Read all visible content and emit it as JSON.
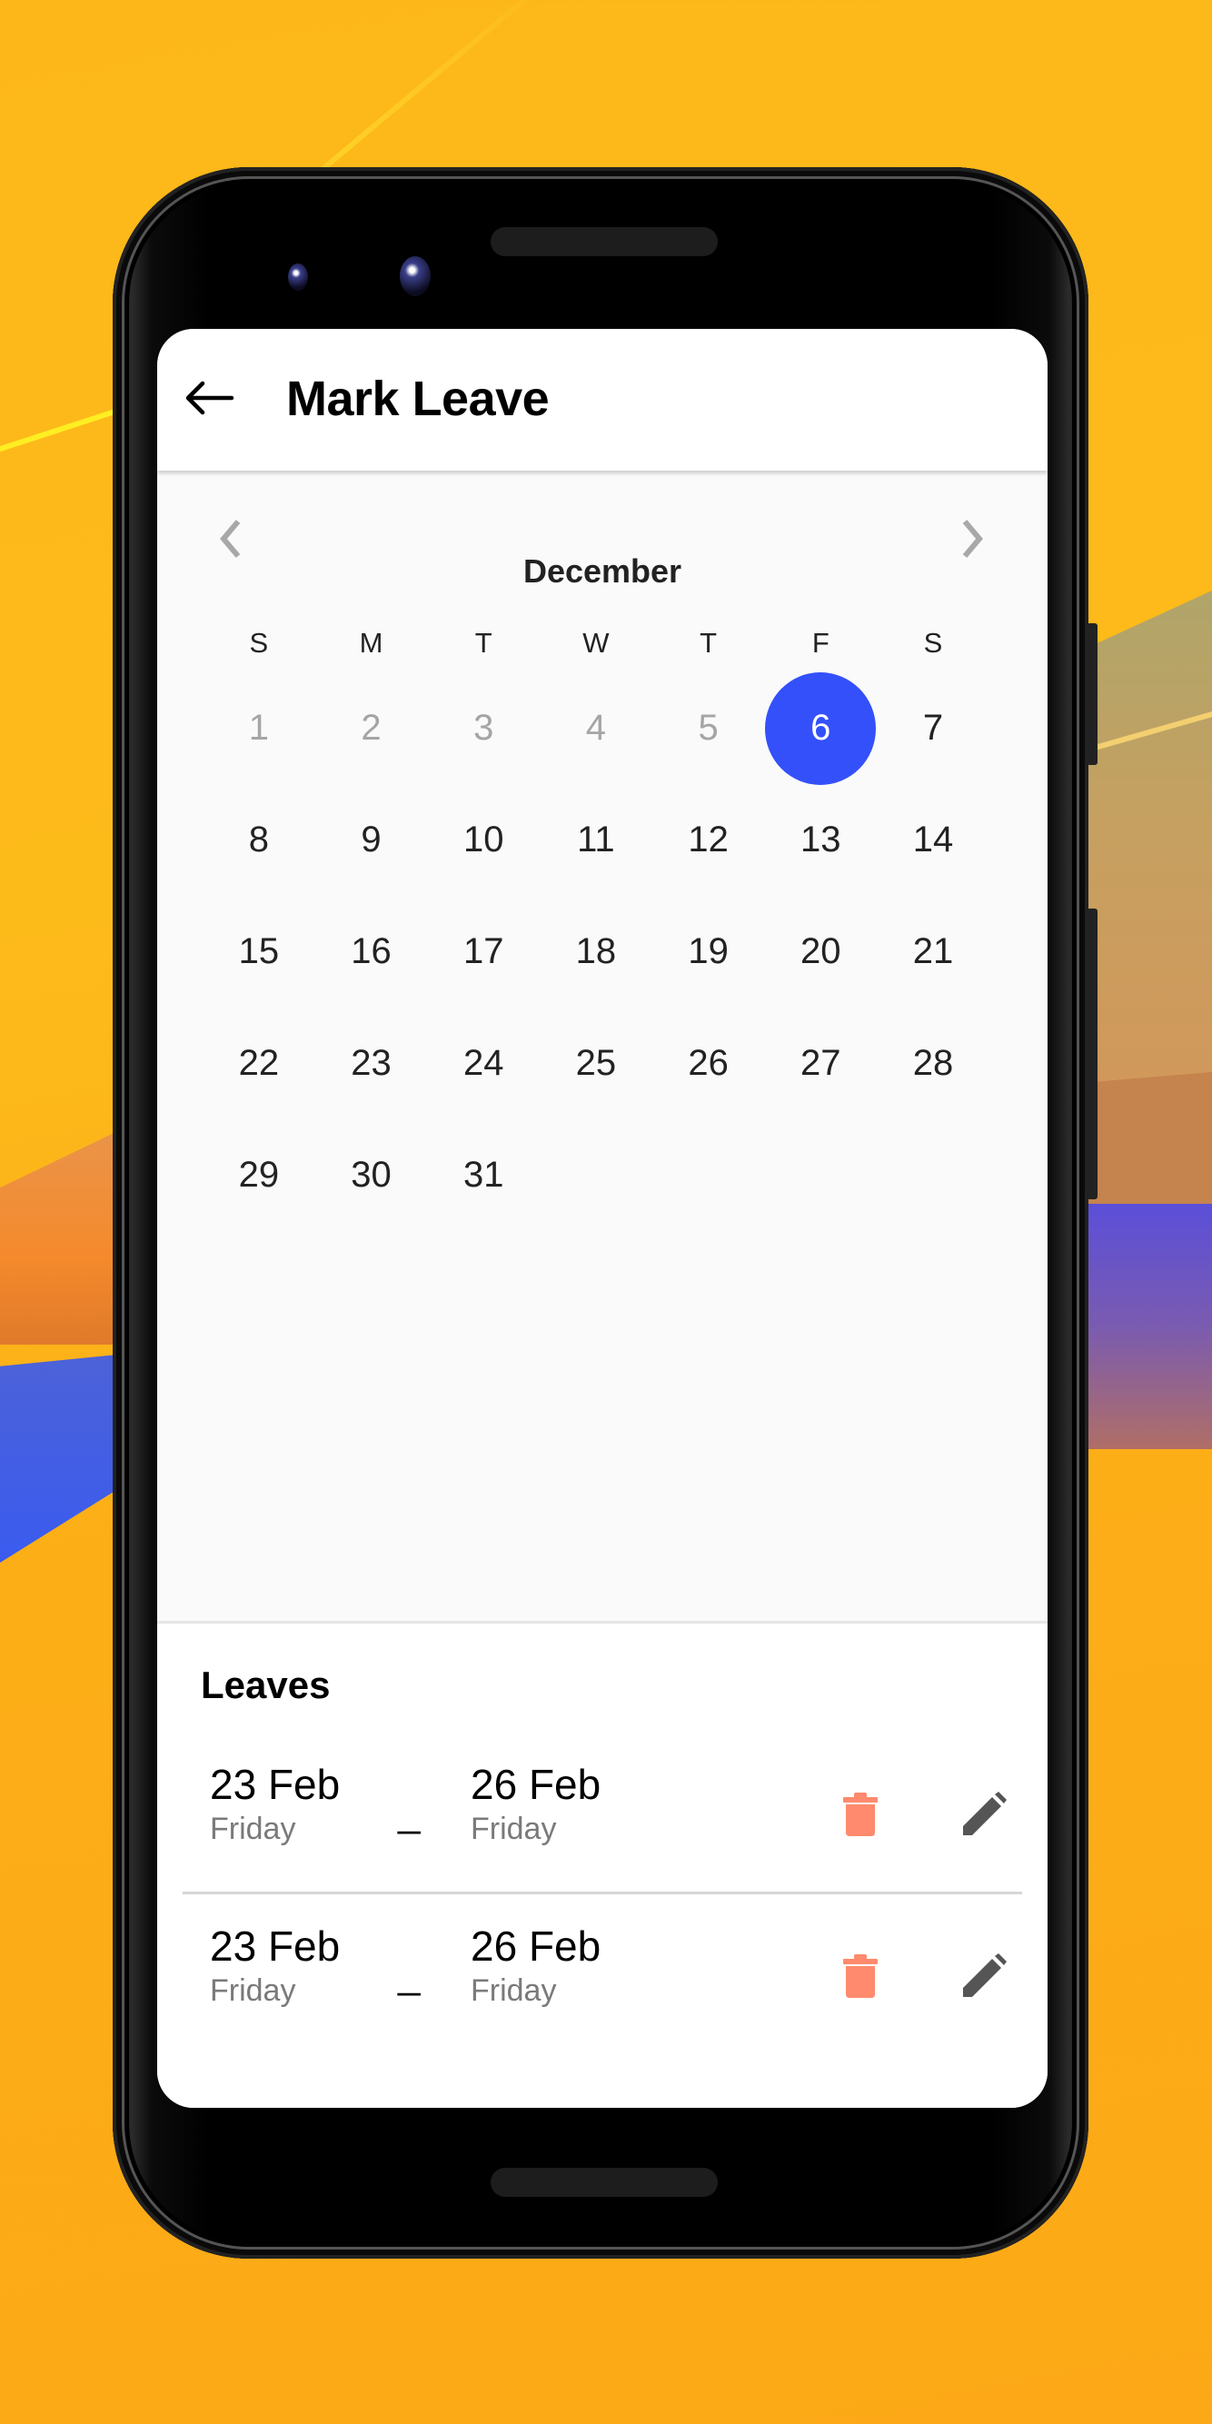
{
  "app_bar": {
    "title": "Mark Leave",
    "back_icon": "arrow-left-icon"
  },
  "calendar": {
    "month": "December",
    "prev_icon": "chevron-left-icon",
    "next_icon": "chevron-right-icon",
    "weekdays": [
      "S",
      "M",
      "T",
      "W",
      "T",
      "F",
      "S"
    ],
    "selected_day": "6",
    "selected_color": "#3450fa",
    "days": [
      {
        "label": "1",
        "muted": true
      },
      {
        "label": "2",
        "muted": true
      },
      {
        "label": "3",
        "muted": true
      },
      {
        "label": "4",
        "muted": true
      },
      {
        "label": "5",
        "muted": true
      },
      {
        "label": "6",
        "selected": true
      },
      {
        "label": "7"
      },
      {
        "label": "8"
      },
      {
        "label": "9"
      },
      {
        "label": "10"
      },
      {
        "label": "11"
      },
      {
        "label": "12"
      },
      {
        "label": "13"
      },
      {
        "label": "14"
      },
      {
        "label": "15"
      },
      {
        "label": "16"
      },
      {
        "label": "17"
      },
      {
        "label": "18"
      },
      {
        "label": "19"
      },
      {
        "label": "20"
      },
      {
        "label": "21"
      },
      {
        "label": "22"
      },
      {
        "label": "23"
      },
      {
        "label": "24"
      },
      {
        "label": "25"
      },
      {
        "label": "26"
      },
      {
        "label": "27"
      },
      {
        "label": "28"
      },
      {
        "label": "29"
      },
      {
        "label": "30"
      },
      {
        "label": "31"
      }
    ]
  },
  "leaves": {
    "title": "Leaves",
    "separator": "_",
    "delete_icon": "trash-icon",
    "edit_icon": "pencil-icon",
    "delete_color": "#ff8a6e",
    "edit_color": "#555555",
    "items": [
      {
        "start_date": "23 Feb",
        "start_day": "Friday",
        "end_date": "26 Feb",
        "end_day": "Friday"
      },
      {
        "start_date": "23 Feb",
        "start_day": "Friday",
        "end_date": "26 Feb",
        "end_day": "Friday"
      }
    ]
  }
}
